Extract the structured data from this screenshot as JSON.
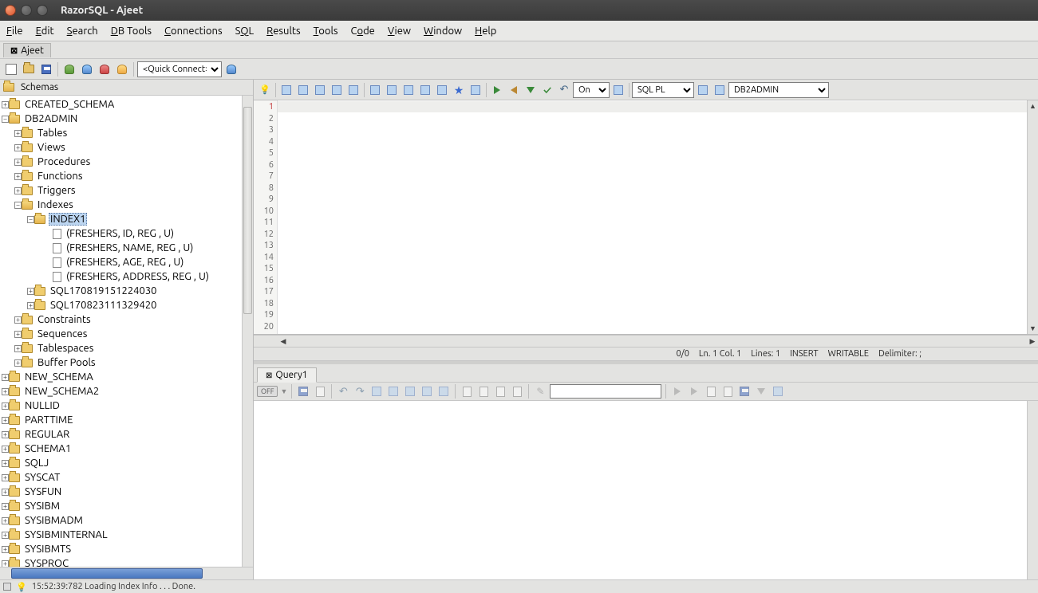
{
  "window": {
    "title": "RazorSQL - Ajeet"
  },
  "menu": [
    "File",
    "Edit",
    "Search",
    "DB Tools",
    "Connections",
    "SQL",
    "Results",
    "Tools",
    "Code",
    "View",
    "Window",
    "Help"
  ],
  "sessionTab": {
    "label": "Ajeet"
  },
  "leftToolbar": {
    "quickConnect": "<Quick Connect>"
  },
  "edToolbar": {
    "on": "On",
    "lang": "SQL PL",
    "schema": "DB2ADMIN"
  },
  "treeHeader": "Schemas",
  "tree": {
    "created_schema": "CREATED_SCHEMA",
    "db2admin": "DB2ADMIN",
    "db2admin_children": [
      "Tables",
      "Views",
      "Procedures",
      "Functions",
      "Triggers"
    ],
    "indexes": "Indexes",
    "index1": "INDEX1",
    "index1_cols": [
      "(FRESHERS, ID, REG , U)",
      "(FRESHERS, NAME, REG , U)",
      "(FRESHERS, AGE, REG , U)",
      "(FRESHERS, ADDRESS, REG , U)"
    ],
    "indexes_siblings": [
      "SQL170819151224030",
      "SQL170823111329420"
    ],
    "db2admin_rest": [
      "Constraints",
      "Sequences",
      "Tablespaces",
      "Buffer Pools"
    ],
    "other_schemas": [
      "NEW_SCHEMA",
      "NEW_SCHEMA2",
      "NULLID",
      "PARTTIME",
      "REGULAR",
      "SCHEMA1",
      "SQLJ",
      "SYSCAT",
      "SYSFUN",
      "SYSIBM",
      "SYSIBMADM",
      "SYSIBMINTERNAL",
      "SYSIBMTS",
      "SYSPROC"
    ]
  },
  "editor": {
    "lineCount": 20
  },
  "status": {
    "ratio": "0/0",
    "pos": "Ln. 1 Col. 1",
    "lines": "Lines: 1",
    "ins": "INSERT",
    "rw": "WRITABLE",
    "delim": "Delimiter: ;"
  },
  "results": {
    "tab": "Query1",
    "off": "OFF"
  },
  "bottom": {
    "msg": "15:52:39:782 Loading Index Info . . . Done."
  }
}
